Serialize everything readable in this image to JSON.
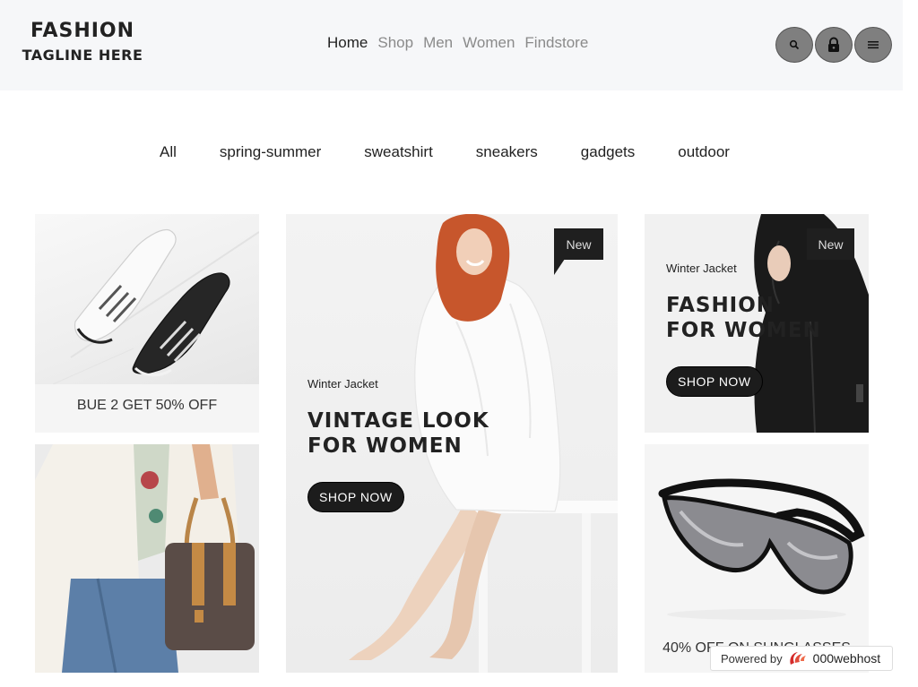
{
  "header": {
    "logo_title": "FASHION",
    "logo_tagline": "TAGLINE HERE",
    "nav": [
      {
        "label": "Home",
        "active": true
      },
      {
        "label": "Shop",
        "active": false
      },
      {
        "label": "Men",
        "active": false
      },
      {
        "label": "Women",
        "active": false
      },
      {
        "label": "Findstore",
        "active": false
      }
    ],
    "buttons": [
      "search-icon",
      "lock-icon",
      "menu-icon"
    ]
  },
  "filters": [
    "All",
    "spring-summer",
    "sweatshirt",
    "sneakers",
    "gadgets",
    "outdoor"
  ],
  "tiles": {
    "shoes": {
      "caption": "BUE 2 GET 50% OFF"
    },
    "center": {
      "badge": "New",
      "subtitle": "Winter Jacket",
      "title_line1": "VINTAGE LOOK",
      "title_line2": "FOR WOMEN",
      "button": "SHOP NOW"
    },
    "right_top": {
      "badge": "New",
      "subtitle": "Winter Jacket",
      "title_line1": "FASHION",
      "title_line2": "FOR WOMEN",
      "button": "SHOP NOW"
    },
    "glasses": {
      "caption": "40% OFF ON SUNGLASSES"
    }
  },
  "powered_by": {
    "label": "Powered by",
    "brand": "000webhost"
  },
  "colors": {
    "header_bg": "#f6f7f9",
    "accent_dark": "#1c1c1c",
    "nav_inactive": "#8a8a8a"
  }
}
